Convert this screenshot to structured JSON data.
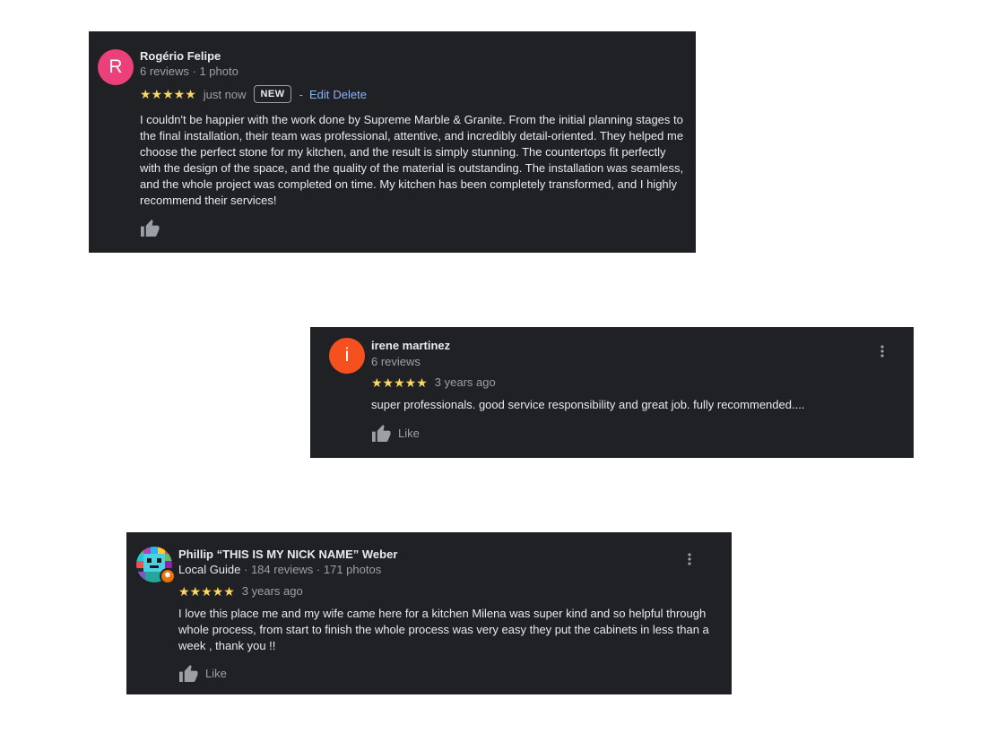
{
  "reviews": [
    {
      "author": "Rogério Felipe",
      "avatar_letter": "R",
      "avatar_color": "#ec407a",
      "meta": "6 reviews · 1 photo",
      "stars": "★★★★★",
      "rating": 5,
      "time": "just now",
      "badge": "NEW",
      "separator": "-",
      "edit_label": "Edit",
      "delete_label": "Delete",
      "text": "I couldn't be happier with the work done by Supreme Marble & Granite. From the initial planning stages to the final installation, their team was professional, attentive, and incredibly detail-oriented. They helped me choose the perfect stone for my kitchen, and the result is simply stunning. The countertops fit perfectly with the design of the space, and the quality of the material is outstanding. The installation was seamless, and the whole project was completed on time. My kitchen has been completely transformed, and I highly recommend their services!",
      "like_icon": "thumbs-up-icon"
    },
    {
      "author": "irene martinez",
      "avatar_letter": "i",
      "avatar_color": "#f4511e",
      "meta": "6 reviews",
      "stars": "★★★★★",
      "rating": 5,
      "time": "3 years ago",
      "text": "super professionals. good service responsibility and great job. fully recommended....",
      "like_label": "Like",
      "like_icon": "thumbs-up-icon",
      "more_icon": "more-vert-icon"
    },
    {
      "author": "Phillip “THIS IS MY NICK NAME” Weber",
      "avatar_icon": "pixel-art-avatar",
      "local_guide": "Local Guide",
      "meta": " · 184 reviews · 171 photos",
      "stars": "★★★★★",
      "rating": 5,
      "time": "3 years ago",
      "text": "I love this place me and my wife came here for a kitchen Milena was super kind and so helpful through whole process, from start to finish the whole process was very easy they put the cabinets in less than a week , thank you !!",
      "like_label": "Like",
      "like_icon": "thumbs-up-icon",
      "more_icon": "more-vert-icon"
    }
  ],
  "colors": {
    "card_bg": "#202124",
    "star": "#fdd663",
    "link": "#8ab4f8",
    "muted": "#9aa0a6",
    "text": "#e8eaed"
  }
}
